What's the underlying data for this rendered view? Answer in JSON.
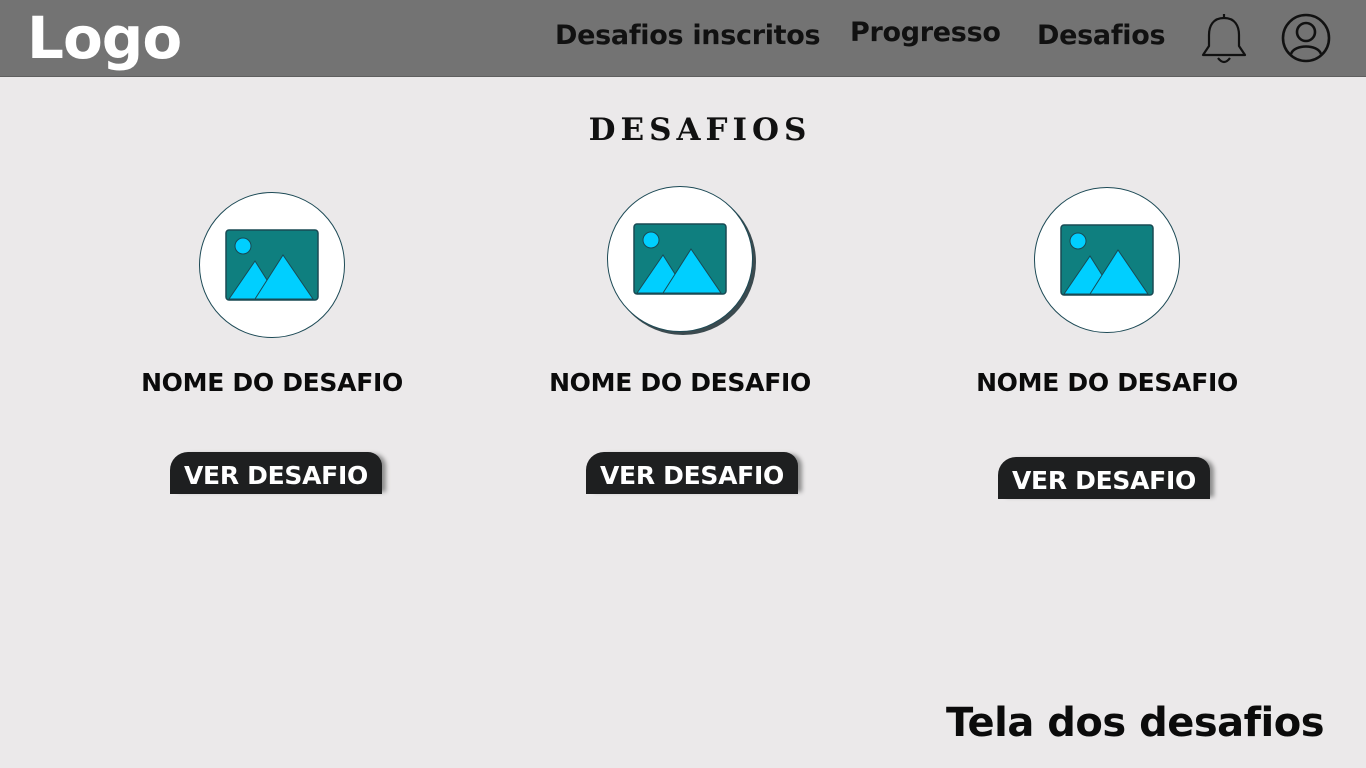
{
  "header": {
    "logo": "Logo",
    "nav": [
      "Desafios inscritos",
      "Progresso",
      "Desafios"
    ],
    "icons": [
      "bell-icon",
      "user-icon"
    ]
  },
  "main": {
    "title": "DESAFIOS",
    "cards": [
      {
        "name": "NOME DO DESAFIO",
        "button": "VER DESAFIO",
        "image_icon": "image-placeholder-icon"
      },
      {
        "name": "NOME DO DESAFIO",
        "button": "VER DESAFIO",
        "image_icon": "image-placeholder-icon"
      },
      {
        "name": "NOME DO DESAFIO",
        "button": "VER DESAFIO",
        "image_icon": "image-placeholder-icon"
      }
    ]
  },
  "footer": {
    "screen_label": "Tela dos desafios"
  },
  "colors": {
    "header_bg": "#737373",
    "page_bg": "#ebe9ea",
    "button_bg": "#1e1f20",
    "image_frame": "#0f7f7f",
    "image_accent": "#00cfff"
  }
}
